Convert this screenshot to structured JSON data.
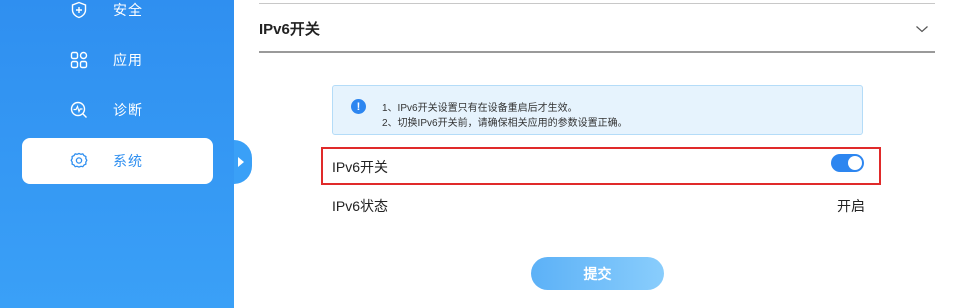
{
  "sidebar": {
    "items": [
      {
        "label": "安全",
        "icon": "shield-plus-icon",
        "active": false
      },
      {
        "label": "应用",
        "icon": "apps-grid-icon",
        "active": false
      },
      {
        "label": "诊断",
        "icon": "diagnose-icon",
        "active": false
      },
      {
        "label": "系统",
        "icon": "gear-icon",
        "active": true
      }
    ]
  },
  "section": {
    "title": "IPv6开关",
    "collapse_icon": "chevron-down-icon"
  },
  "notice": {
    "icon": "info-icon",
    "lines": [
      "1、IPv6开关设置只有在设备重启后才生效。",
      "2、切换IPv6开关前，请确保相关应用的参数设置正确。"
    ]
  },
  "settings": {
    "ipv6_switch": {
      "label": "IPv6开关",
      "enabled": true
    },
    "ipv6_status": {
      "label": "IPv6状态",
      "value": "开启"
    }
  },
  "actions": {
    "submit_label": "提交"
  },
  "colors": {
    "sidebar": "#3aa0f7",
    "accent": "#2d86f0",
    "highlight": "#e02a2a",
    "notice_bg": "#e6f3fd"
  }
}
